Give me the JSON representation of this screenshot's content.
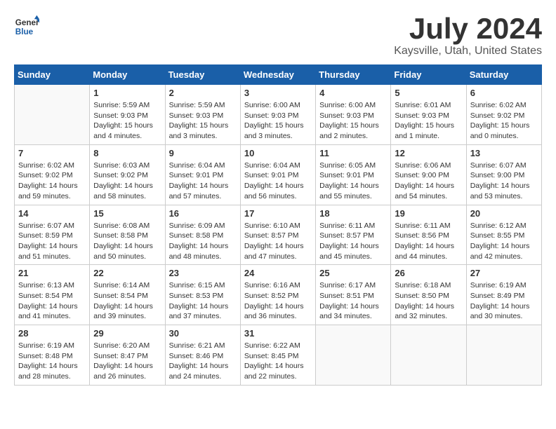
{
  "logo": {
    "general": "General",
    "blue": "Blue"
  },
  "title": "July 2024",
  "location": "Kaysville, Utah, United States",
  "weekdays": [
    "Sunday",
    "Monday",
    "Tuesday",
    "Wednesday",
    "Thursday",
    "Friday",
    "Saturday"
  ],
  "weeks": [
    [
      {
        "day": "",
        "info": ""
      },
      {
        "day": "1",
        "info": "Sunrise: 5:59 AM\nSunset: 9:03 PM\nDaylight: 15 hours\nand 4 minutes."
      },
      {
        "day": "2",
        "info": "Sunrise: 5:59 AM\nSunset: 9:03 PM\nDaylight: 15 hours\nand 3 minutes."
      },
      {
        "day": "3",
        "info": "Sunrise: 6:00 AM\nSunset: 9:03 PM\nDaylight: 15 hours\nand 3 minutes."
      },
      {
        "day": "4",
        "info": "Sunrise: 6:00 AM\nSunset: 9:03 PM\nDaylight: 15 hours\nand 2 minutes."
      },
      {
        "day": "5",
        "info": "Sunrise: 6:01 AM\nSunset: 9:03 PM\nDaylight: 15 hours\nand 1 minute."
      },
      {
        "day": "6",
        "info": "Sunrise: 6:02 AM\nSunset: 9:02 PM\nDaylight: 15 hours\nand 0 minutes."
      }
    ],
    [
      {
        "day": "7",
        "info": "Sunrise: 6:02 AM\nSunset: 9:02 PM\nDaylight: 14 hours\nand 59 minutes."
      },
      {
        "day": "8",
        "info": "Sunrise: 6:03 AM\nSunset: 9:02 PM\nDaylight: 14 hours\nand 58 minutes."
      },
      {
        "day": "9",
        "info": "Sunrise: 6:04 AM\nSunset: 9:01 PM\nDaylight: 14 hours\nand 57 minutes."
      },
      {
        "day": "10",
        "info": "Sunrise: 6:04 AM\nSunset: 9:01 PM\nDaylight: 14 hours\nand 56 minutes."
      },
      {
        "day": "11",
        "info": "Sunrise: 6:05 AM\nSunset: 9:01 PM\nDaylight: 14 hours\nand 55 minutes."
      },
      {
        "day": "12",
        "info": "Sunrise: 6:06 AM\nSunset: 9:00 PM\nDaylight: 14 hours\nand 54 minutes."
      },
      {
        "day": "13",
        "info": "Sunrise: 6:07 AM\nSunset: 9:00 PM\nDaylight: 14 hours\nand 53 minutes."
      }
    ],
    [
      {
        "day": "14",
        "info": "Sunrise: 6:07 AM\nSunset: 8:59 PM\nDaylight: 14 hours\nand 51 minutes."
      },
      {
        "day": "15",
        "info": "Sunrise: 6:08 AM\nSunset: 8:58 PM\nDaylight: 14 hours\nand 50 minutes."
      },
      {
        "day": "16",
        "info": "Sunrise: 6:09 AM\nSunset: 8:58 PM\nDaylight: 14 hours\nand 48 minutes."
      },
      {
        "day": "17",
        "info": "Sunrise: 6:10 AM\nSunset: 8:57 PM\nDaylight: 14 hours\nand 47 minutes."
      },
      {
        "day": "18",
        "info": "Sunrise: 6:11 AM\nSunset: 8:57 PM\nDaylight: 14 hours\nand 45 minutes."
      },
      {
        "day": "19",
        "info": "Sunrise: 6:11 AM\nSunset: 8:56 PM\nDaylight: 14 hours\nand 44 minutes."
      },
      {
        "day": "20",
        "info": "Sunrise: 6:12 AM\nSunset: 8:55 PM\nDaylight: 14 hours\nand 42 minutes."
      }
    ],
    [
      {
        "day": "21",
        "info": "Sunrise: 6:13 AM\nSunset: 8:54 PM\nDaylight: 14 hours\nand 41 minutes."
      },
      {
        "day": "22",
        "info": "Sunrise: 6:14 AM\nSunset: 8:54 PM\nDaylight: 14 hours\nand 39 minutes."
      },
      {
        "day": "23",
        "info": "Sunrise: 6:15 AM\nSunset: 8:53 PM\nDaylight: 14 hours\nand 37 minutes."
      },
      {
        "day": "24",
        "info": "Sunrise: 6:16 AM\nSunset: 8:52 PM\nDaylight: 14 hours\nand 36 minutes."
      },
      {
        "day": "25",
        "info": "Sunrise: 6:17 AM\nSunset: 8:51 PM\nDaylight: 14 hours\nand 34 minutes."
      },
      {
        "day": "26",
        "info": "Sunrise: 6:18 AM\nSunset: 8:50 PM\nDaylight: 14 hours\nand 32 minutes."
      },
      {
        "day": "27",
        "info": "Sunrise: 6:19 AM\nSunset: 8:49 PM\nDaylight: 14 hours\nand 30 minutes."
      }
    ],
    [
      {
        "day": "28",
        "info": "Sunrise: 6:19 AM\nSunset: 8:48 PM\nDaylight: 14 hours\nand 28 minutes."
      },
      {
        "day": "29",
        "info": "Sunrise: 6:20 AM\nSunset: 8:47 PM\nDaylight: 14 hours\nand 26 minutes."
      },
      {
        "day": "30",
        "info": "Sunrise: 6:21 AM\nSunset: 8:46 PM\nDaylight: 14 hours\nand 24 minutes."
      },
      {
        "day": "31",
        "info": "Sunrise: 6:22 AM\nSunset: 8:45 PM\nDaylight: 14 hours\nand 22 minutes."
      },
      {
        "day": "",
        "info": ""
      },
      {
        "day": "",
        "info": ""
      },
      {
        "day": "",
        "info": ""
      }
    ]
  ]
}
